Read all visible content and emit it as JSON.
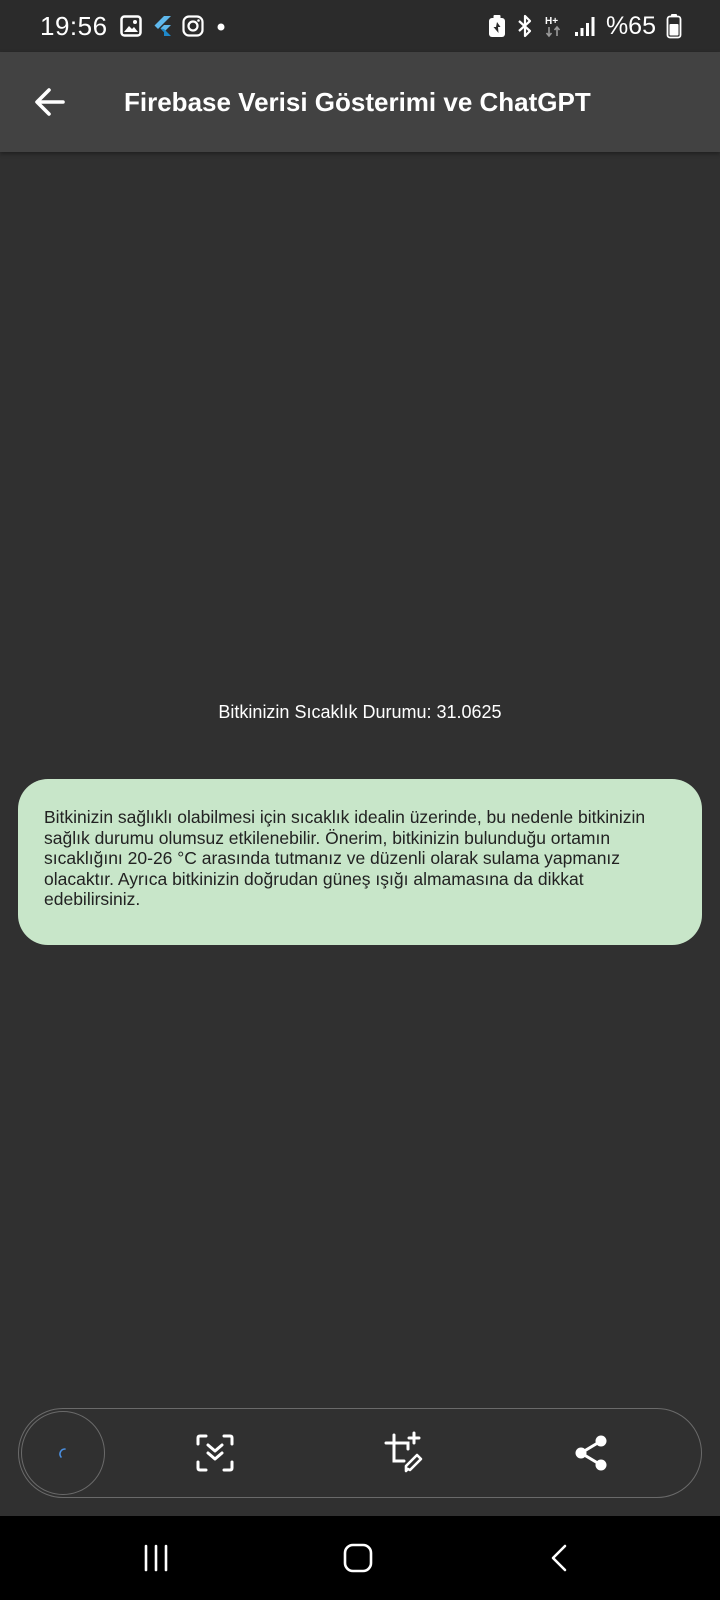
{
  "status_bar": {
    "time": "19:56",
    "battery": "%65",
    "notification_icons": [
      "gallery-icon",
      "flutter-icon",
      "instagram-icon",
      "dot-icon"
    ],
    "system_icons": [
      "battery-saver-icon",
      "bluetooth-icon",
      "network-hplus-icon",
      "signal-icon",
      "battery-icon"
    ]
  },
  "app_bar": {
    "title": "Firebase Verisi Gösterimi ve ChatGPT",
    "back_icon": "arrow-back-icon"
  },
  "main": {
    "temperature_text": "Bitkinizin Sıcaklık Durumu: 31.0625",
    "advice_text": "Bitkinizin sağlıklı olabilmesi için sıcaklık idealin üzerinde, bu nedenle bitkinizin sağlık durumu olumsuz etkilenebilir. Önerim, bitkinizin bulunduğu ortamın sıcaklığını 20-26 °C arasında tutmanız ve düzenli olarak sulama yapmanız olacaktır. Ayrıca bitkinizin doğrudan güneş ışığı almamasına da dikkat edebilirsiniz.",
    "advice_bubble_color": "#c8e6c9"
  },
  "action_bar": {
    "items": [
      "loading-spinner-icon",
      "scroll-capture-icon",
      "crop-edit-icon",
      "share-icon"
    ]
  },
  "nav_bar": {
    "items": [
      "recents-icon",
      "home-icon",
      "back-icon"
    ]
  },
  "colors": {
    "background": "#303030",
    "app_bar": "#424242",
    "status_bar": "#2b2b2b",
    "nav_bar": "#000000"
  }
}
